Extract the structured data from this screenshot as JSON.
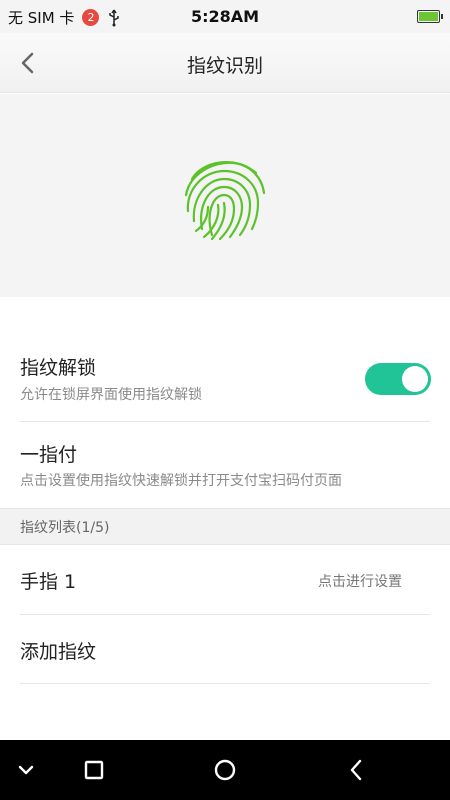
{
  "status_bar": {
    "carrier": "无 SIM 卡",
    "badge_count": "2",
    "time": "5:28AM",
    "icons": [
      "notification-badge",
      "usb-icon",
      "battery-icon"
    ],
    "battery_color": "#6cc633"
  },
  "app_bar": {
    "title": "指纹识别",
    "back_icon": "chevron-left-icon"
  },
  "hero": {
    "icon": "fingerprint-icon",
    "color": "#5cc22a"
  },
  "settings": {
    "unlock": {
      "title": "指纹解锁",
      "subtitle": "允许在锁屏界面使用指纹解锁",
      "toggle_on": true,
      "toggle_color": "#20c497"
    },
    "pay": {
      "title": "一指付",
      "subtitle": "点击设置使用指纹快速解锁并打开支付宝扫码付页面"
    }
  },
  "fingerprint_list": {
    "header": "指纹列表(1/5)",
    "items": [
      {
        "label": "手指 1",
        "action": "点击进行设置"
      }
    ],
    "add_label": "添加指纹"
  },
  "nav_bar": {
    "buttons": [
      "chevron-down-icon",
      "square-icon",
      "circle-icon",
      "chevron-left-icon"
    ]
  }
}
